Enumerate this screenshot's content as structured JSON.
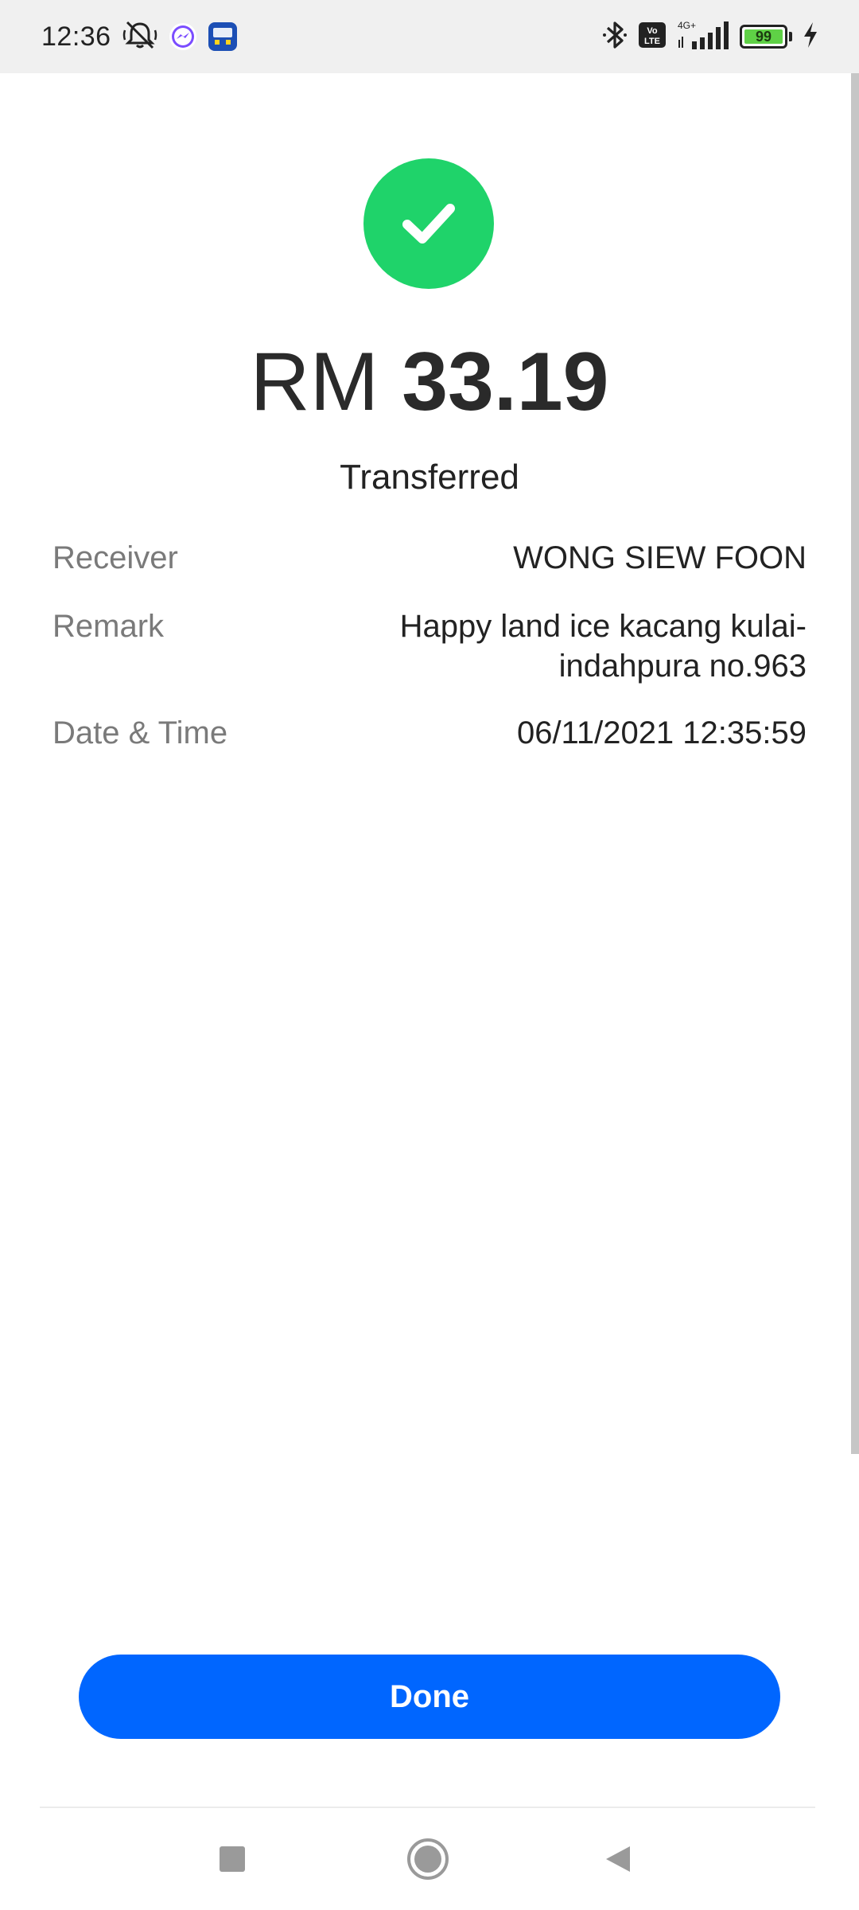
{
  "status_bar": {
    "time": "12:36",
    "battery_level": "99",
    "network_label": "4G+",
    "volte_label": "Vo LTE",
    "left_icons": [
      "mute-icon",
      "messenger-icon",
      "app-badge-icon"
    ],
    "right_icons": [
      "bluetooth-icon",
      "volte-icon",
      "signal-icon",
      "battery-icon",
      "charging-icon"
    ]
  },
  "receipt": {
    "currency": "RM",
    "amount": "33.19",
    "status": "Transferred",
    "success_color": "#1fd36a",
    "rows": [
      {
        "label": "Receiver",
        "value": "WONG SIEW FOON"
      },
      {
        "label": "Remark",
        "value": "Happy land ice kacang kulai-indahpura no.963"
      },
      {
        "label": "Date & Time",
        "value": "06/11/2021 12:35:59"
      }
    ]
  },
  "actions": {
    "done_label": "Done",
    "done_color": "#0066ff"
  },
  "nav_bar": {
    "icons": [
      "recents-square-icon",
      "home-circle-icon",
      "back-triangle-icon"
    ]
  }
}
